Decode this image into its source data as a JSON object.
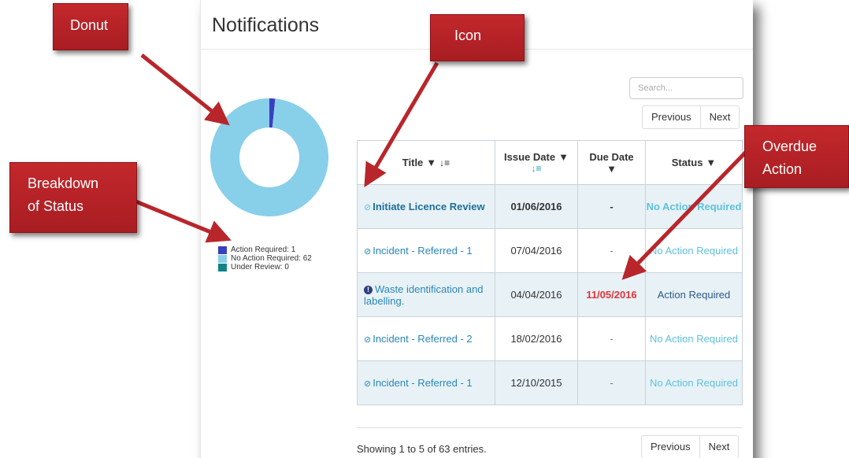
{
  "page": {
    "title": "Notifications"
  },
  "search": {
    "placeholder": "Search..."
  },
  "pager": {
    "previous": "Previous",
    "next": "Next"
  },
  "donut": {
    "segments": [
      {
        "label": "Action Required",
        "value": 1,
        "color": "#3a3fbf"
      },
      {
        "label": "No Action Required",
        "value": 62,
        "color": "#88cfea"
      },
      {
        "label": "Under Review",
        "value": 0,
        "color": "#138287"
      }
    ]
  },
  "legend": [
    {
      "text": "Action Required: 1",
      "color": "#3a3fbf"
    },
    {
      "text": "No Action Required: 62",
      "color": "#88cfea"
    },
    {
      "text": "Under Review: 0",
      "color": "#138287"
    }
  ],
  "table": {
    "headers": {
      "title": "Title",
      "issue_date": "Issue Date",
      "due_date": "Due Date",
      "status": "Status"
    },
    "rows": [
      {
        "title": "Initiate Licence Review",
        "issue_date": "01/06/2016",
        "due_date": "-",
        "status": "No Action Required",
        "icon": "check-circle-icon"
      },
      {
        "title": "Incident - Referred - 1",
        "issue_date": "07/04/2016",
        "due_date": "-",
        "status": "No Action Required",
        "icon": "check-circle-icon"
      },
      {
        "title": "Waste identification and labelling.",
        "issue_date": "04/04/2016",
        "due_date": "11/05/2016",
        "status": "Action Required",
        "icon": "exclamation-circle-icon"
      },
      {
        "title": "Incident - Referred - 2",
        "issue_date": "18/02/2016",
        "due_date": "-",
        "status": "No Action Required",
        "icon": "check-circle-icon"
      },
      {
        "title": "Incident - Referred - 1",
        "issue_date": "12/10/2015",
        "due_date": "-",
        "status": "No Action Required",
        "icon": "check-circle-icon"
      }
    ]
  },
  "footer": {
    "info": "Showing 1 to 5 of 63 entries."
  },
  "callouts": {
    "donut": "Donut",
    "icon": "Icon",
    "breakdown_1": "Breakdown",
    "breakdown_2": "of Status",
    "overdue_1": "Overdue",
    "overdue_2": "Action"
  }
}
